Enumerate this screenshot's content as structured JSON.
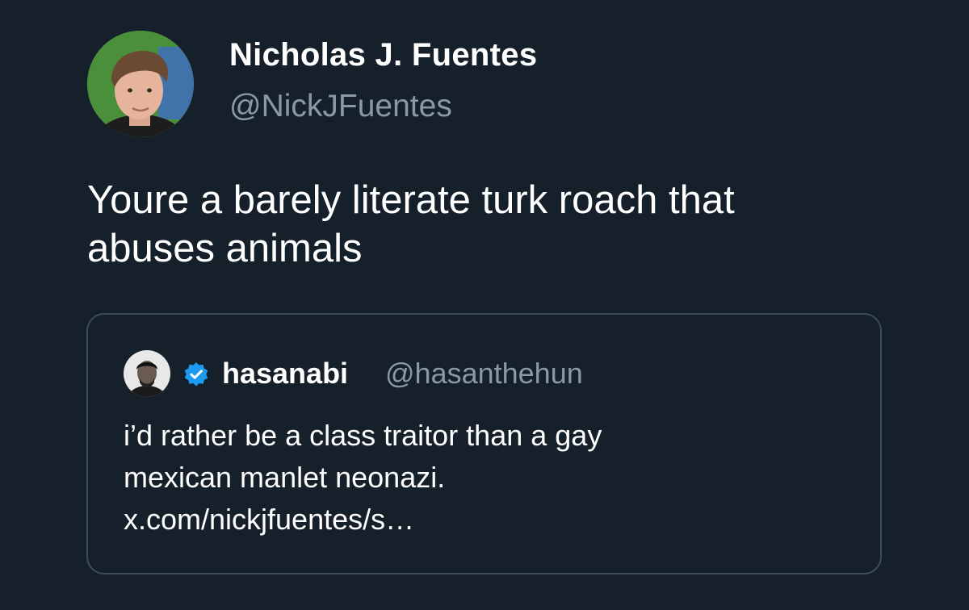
{
  "tweet": {
    "author": {
      "display_name": "Nicholas J. Fuentes",
      "handle": "@NickJFuentes",
      "avatar_icon": "profile-photo"
    },
    "text_lines": [
      "Youre a barely literate turk roach that",
      "abuses animals"
    ]
  },
  "quote": {
    "author": {
      "display_name": "hasanabi",
      "handle": "@hasanthehun",
      "avatar_icon": "profile-photo",
      "verified_icon": "verified-badge-icon"
    },
    "text_lines": [
      "i’d rather be a class traitor than a gay",
      "mexican manlet neonazi.",
      "x.com/nickjfuentes/s…"
    ]
  },
  "colors": {
    "background": "#15202b",
    "primary_text": "#ffffff",
    "secondary_text": "#8b98a5",
    "card_border": "#3e4d5b",
    "verified_blue": "#1d9bf0"
  }
}
